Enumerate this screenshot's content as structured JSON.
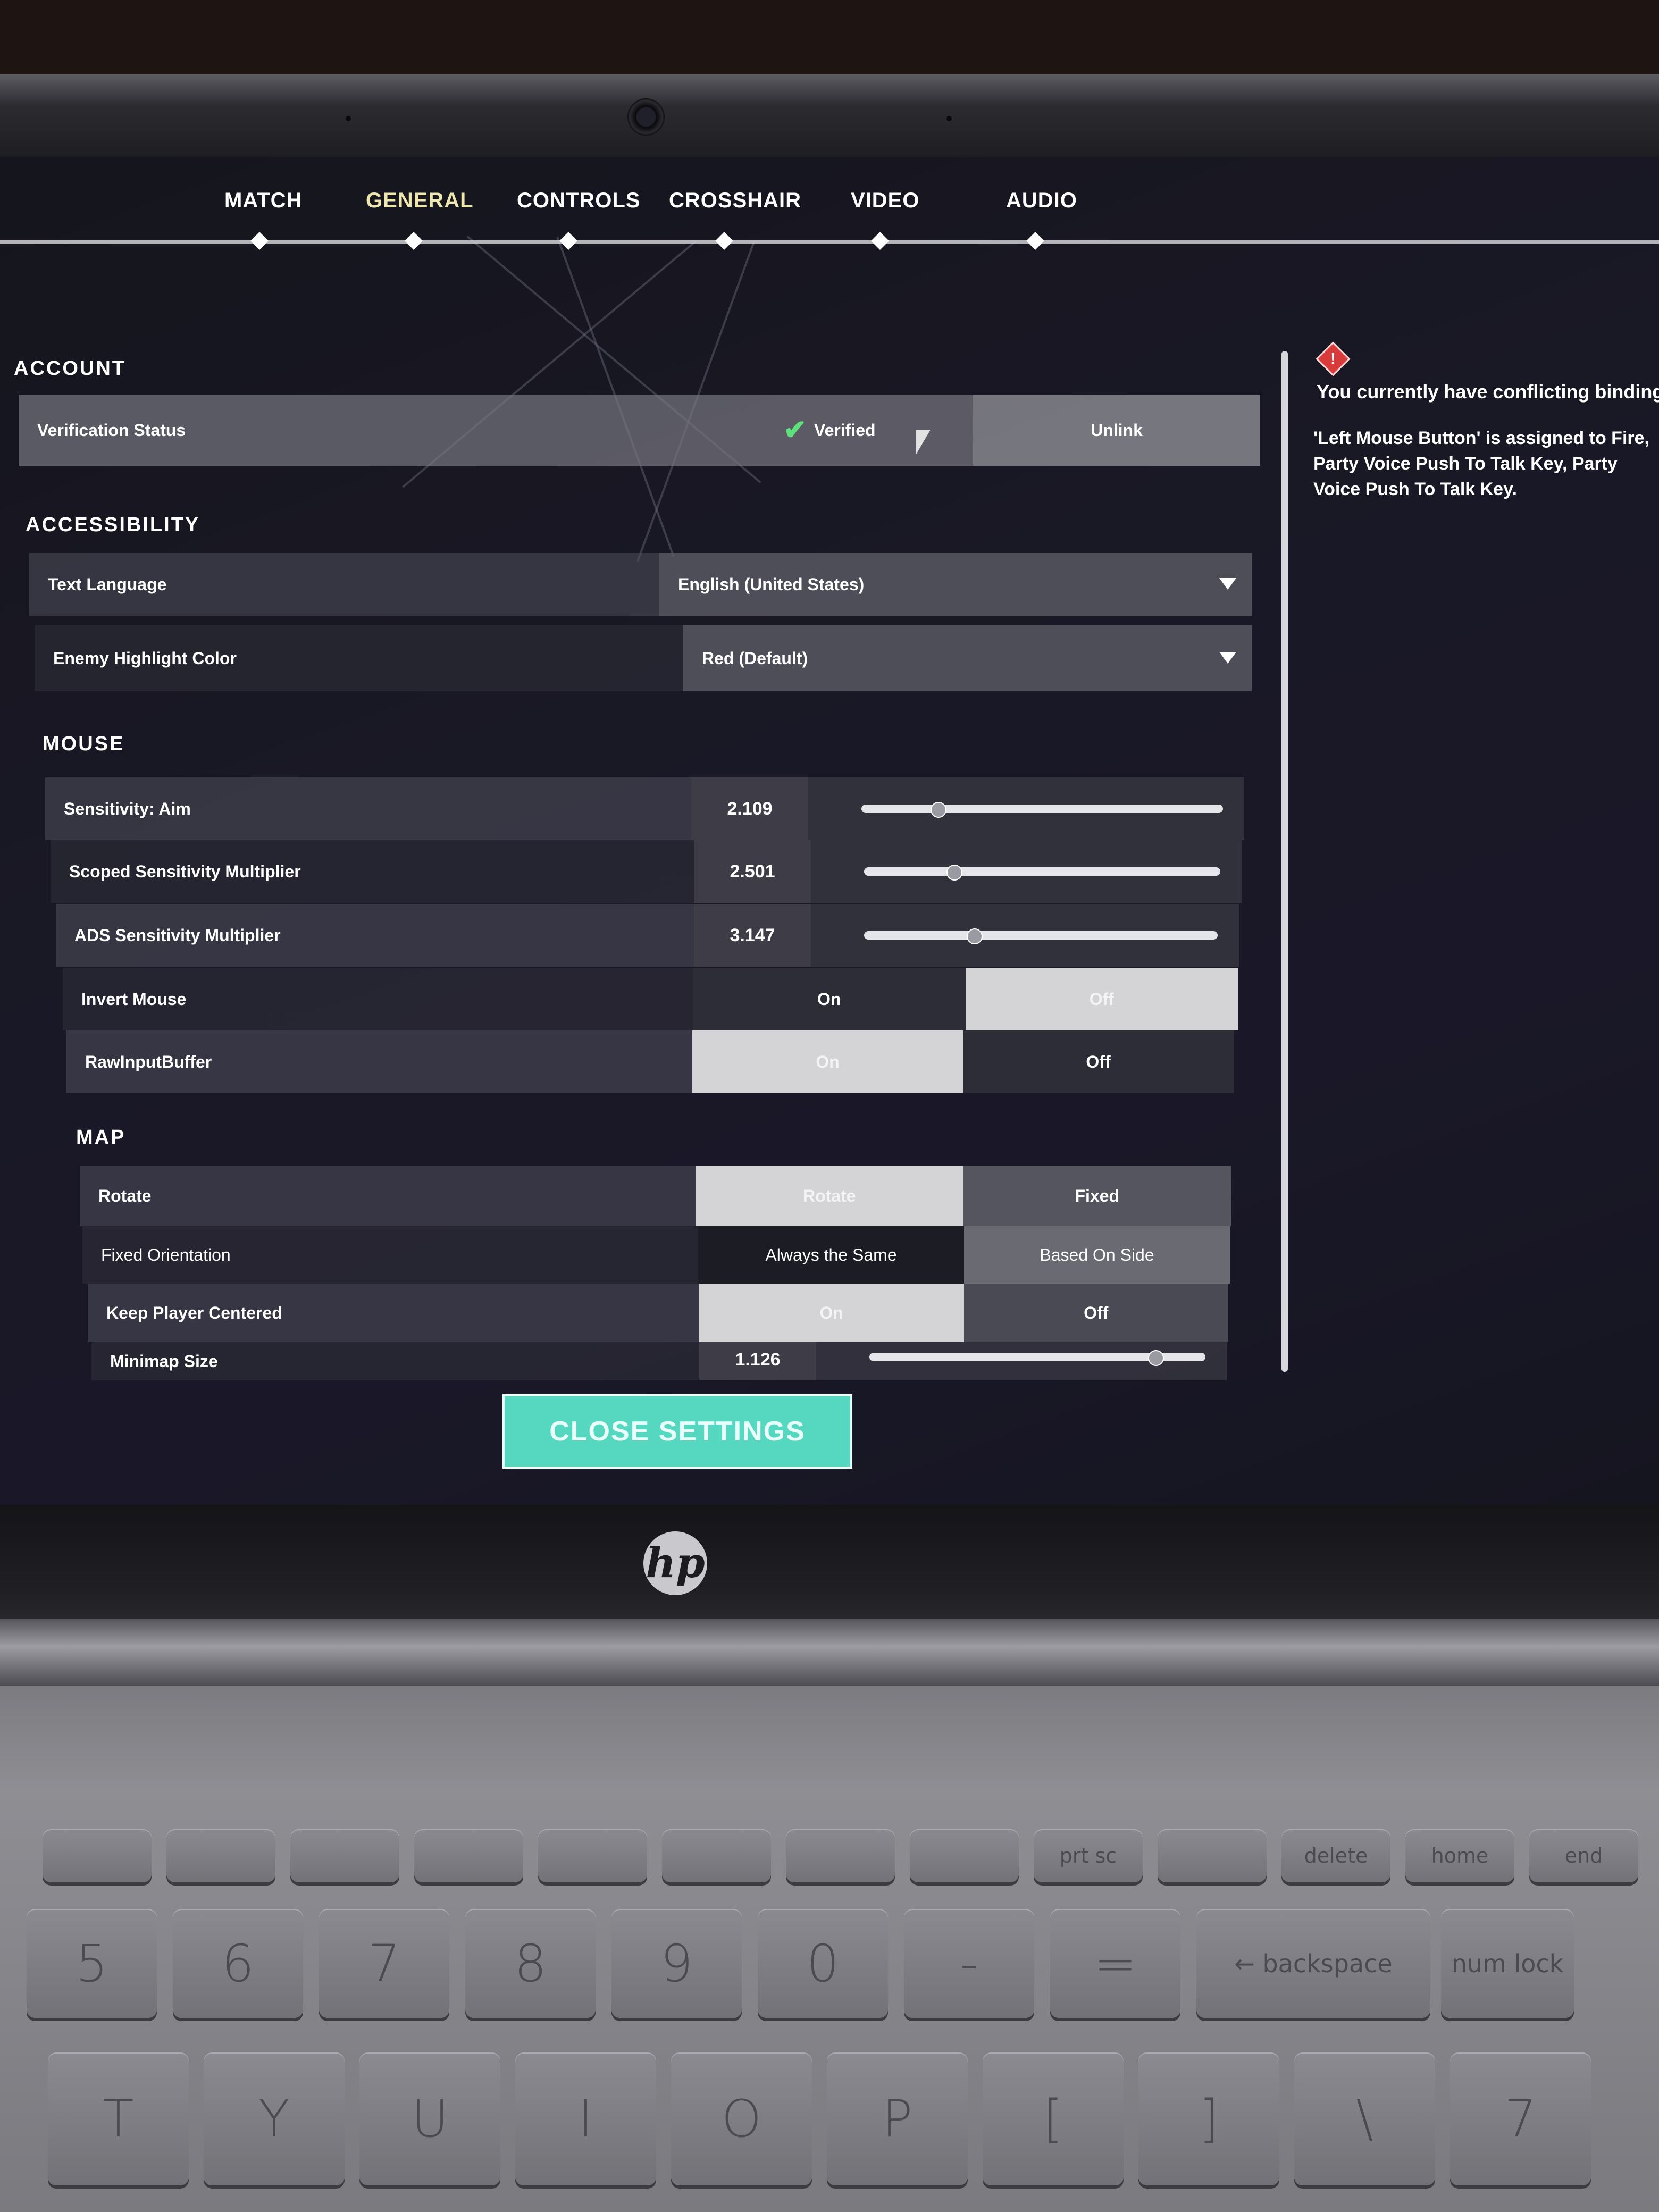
{
  "nav": {
    "tabs": [
      {
        "label": "MATCH",
        "active": false
      },
      {
        "label": "GENERAL",
        "active": true
      },
      {
        "label": "CONTROLS",
        "active": false
      },
      {
        "label": "CROSSHAIR",
        "active": false
      },
      {
        "label": "VIDEO",
        "active": false
      },
      {
        "label": "AUDIO",
        "active": false
      }
    ]
  },
  "account": {
    "title": "ACCOUNT",
    "verification_label": "Verification Status",
    "verified_label": "Verified",
    "unlink_label": "Unlink"
  },
  "accessibility": {
    "title": "ACCESSIBILITY",
    "text_language_label": "Text Language",
    "text_language_value": "English (United States)",
    "enemy_highlight_label": "Enemy Highlight Color",
    "enemy_highlight_value": "Red (Default)"
  },
  "mouse": {
    "title": "MOUSE",
    "sensitivity_label": "Sensitivity: Aim",
    "sensitivity_value": "2.109",
    "sensitivity_fraction": 0.21,
    "scoped_label": "Scoped Sensitivity Multiplier",
    "scoped_value": "2.501",
    "scoped_fraction": 0.25,
    "ads_label": "ADS Sensitivity Multiplier",
    "ads_value": "3.147",
    "ads_fraction": 0.31,
    "invert_label": "Invert Mouse",
    "invert_on": "On",
    "invert_off": "Off",
    "raw_label": "RawInputBuffer",
    "raw_on": "On",
    "raw_off": "Off"
  },
  "map": {
    "title": "MAP",
    "rotate_label": "Rotate",
    "rotate_option": "Rotate",
    "fixed_option": "Fixed",
    "orientation_label": "Fixed Orientation",
    "orientation_same": "Always the Same",
    "orientation_side": "Based On Side",
    "center_label": "Keep Player Centered",
    "center_on": "On",
    "center_off": "Off",
    "minimap_label": "Minimap Size",
    "minimap_value": "1.126",
    "minimap_fraction": 0.85
  },
  "conflicts": {
    "title": "You currently have conflicting bindings:",
    "body": "'Left Mouse Button' is assigned to Fire, Party Voice Push To Talk Key, Party Voice Push To Talk Key."
  },
  "footer": {
    "close_label": "CLOSE SETTINGS"
  },
  "keyboard": {
    "fn_row": [
      "",
      "",
      "",
      "",
      "",
      "",
      "",
      "",
      "prt sc",
      "",
      "delete",
      "home",
      "end"
    ],
    "num_row": [
      "5",
      "6",
      "7",
      "8",
      "9",
      "0",
      "-",
      "=",
      "← backspace",
      "num lock"
    ],
    "letter_row": [
      "T",
      "Y",
      "U",
      "I",
      "O",
      "P",
      "[",
      "]",
      "\\",
      "7"
    ]
  },
  "colors": {
    "accent_close": "#56d8c0",
    "active_tab": "#efe7b0",
    "warning": "#d93a3a"
  }
}
